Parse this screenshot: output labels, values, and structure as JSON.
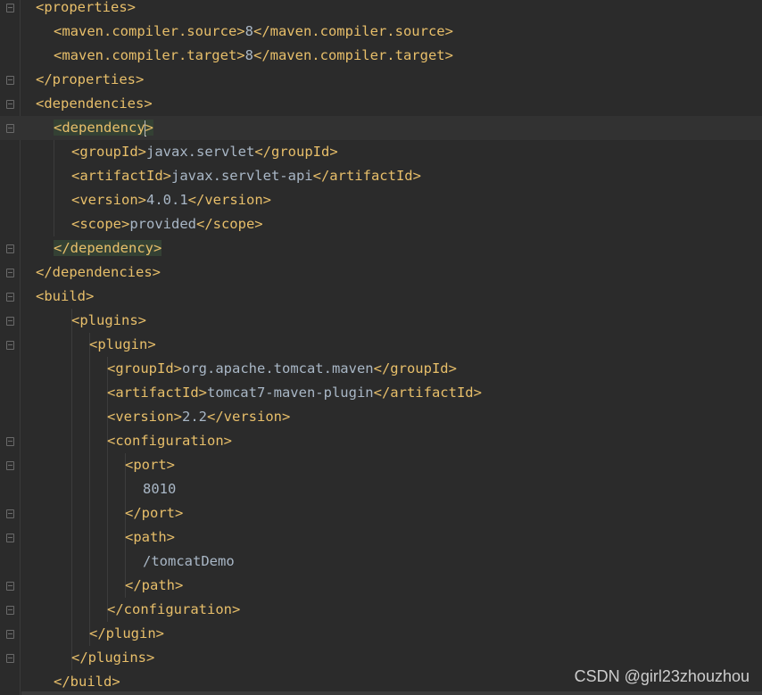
{
  "editor": {
    "lines": [
      {
        "indent": 2,
        "parts": [
          {
            "k": "tag",
            "t": "<properties>"
          }
        ]
      },
      {
        "indent": 3,
        "parts": [
          {
            "k": "tag",
            "t": "<maven.compiler.source>"
          },
          {
            "k": "txt",
            "t": "8"
          },
          {
            "k": "tag",
            "t": "</maven.compiler.source>"
          }
        ]
      },
      {
        "indent": 3,
        "parts": [
          {
            "k": "tag",
            "t": "<maven.compiler.target>"
          },
          {
            "k": "txt",
            "t": "8"
          },
          {
            "k": "tag",
            "t": "</maven.compiler.target>"
          }
        ]
      },
      {
        "indent": 2,
        "parts": [
          {
            "k": "tag",
            "t": "</properties>"
          }
        ]
      },
      {
        "indent": 2,
        "parts": [
          {
            "k": "tag",
            "t": "<dependencies>"
          }
        ]
      },
      {
        "indent": 3,
        "current": true,
        "parts": [
          {
            "k": "tag hl",
            "t": "<dependency"
          },
          {
            "k": "caret",
            "t": ""
          },
          {
            "k": "tag hl",
            "t": ">"
          }
        ]
      },
      {
        "indent": 4,
        "parts": [
          {
            "k": "tag",
            "t": "<groupId>"
          },
          {
            "k": "txt",
            "t": "javax.servlet"
          },
          {
            "k": "tag",
            "t": "</groupId>"
          }
        ]
      },
      {
        "indent": 4,
        "parts": [
          {
            "k": "tag",
            "t": "<artifactId>"
          },
          {
            "k": "txt",
            "t": "javax.servlet-api"
          },
          {
            "k": "tag",
            "t": "</artifactId>"
          }
        ]
      },
      {
        "indent": 4,
        "parts": [
          {
            "k": "tag",
            "t": "<version>"
          },
          {
            "k": "txt",
            "t": "4.0.1"
          },
          {
            "k": "tag",
            "t": "</version>"
          }
        ]
      },
      {
        "indent": 4,
        "parts": [
          {
            "k": "tag",
            "t": "<scope>"
          },
          {
            "k": "txt",
            "t": "provided"
          },
          {
            "k": "tag",
            "t": "</scope>"
          }
        ]
      },
      {
        "indent": 3,
        "parts": [
          {
            "k": "tag hl",
            "t": "</dependency>"
          }
        ]
      },
      {
        "indent": 2,
        "parts": [
          {
            "k": "tag",
            "t": "</dependencies>"
          }
        ]
      },
      {
        "indent": 2,
        "parts": [
          {
            "k": "tag",
            "t": "<build>"
          }
        ]
      },
      {
        "indent": 4,
        "parts": [
          {
            "k": "tag",
            "t": "<plugins>"
          }
        ]
      },
      {
        "indent": 5,
        "parts": [
          {
            "k": "tag",
            "t": "<plugin>"
          }
        ]
      },
      {
        "indent": 6,
        "parts": [
          {
            "k": "tag",
            "t": "<groupId>"
          },
          {
            "k": "txt",
            "t": "org.apache.tomcat.maven"
          },
          {
            "k": "tag",
            "t": "</groupId>"
          }
        ]
      },
      {
        "indent": 6,
        "parts": [
          {
            "k": "tag",
            "t": "<artifactId>"
          },
          {
            "k": "txt",
            "t": "tomcat7-maven-plugin"
          },
          {
            "k": "tag",
            "t": "</artifactId>"
          }
        ]
      },
      {
        "indent": 6,
        "parts": [
          {
            "k": "tag",
            "t": "<version>"
          },
          {
            "k": "txt",
            "t": "2.2"
          },
          {
            "k": "tag",
            "t": "</version>"
          }
        ]
      },
      {
        "indent": 6,
        "parts": [
          {
            "k": "tag",
            "t": "<configuration>"
          }
        ]
      },
      {
        "indent": 7,
        "parts": [
          {
            "k": "tag",
            "t": "<port>"
          }
        ]
      },
      {
        "indent": 8,
        "parts": [
          {
            "k": "txt",
            "t": "8010"
          }
        ]
      },
      {
        "indent": 7,
        "parts": [
          {
            "k": "tag",
            "t": "</port>"
          }
        ]
      },
      {
        "indent": 7,
        "parts": [
          {
            "k": "tag",
            "t": "<path>"
          }
        ]
      },
      {
        "indent": 8,
        "parts": [
          {
            "k": "txt",
            "t": "/tomcatDemo"
          }
        ]
      },
      {
        "indent": 7,
        "parts": [
          {
            "k": "tag",
            "t": "</path>"
          }
        ]
      },
      {
        "indent": 6,
        "parts": [
          {
            "k": "tag",
            "t": "</configuration>"
          }
        ]
      },
      {
        "indent": 5,
        "parts": [
          {
            "k": "tag",
            "t": "</plugin>"
          }
        ]
      },
      {
        "indent": 4,
        "parts": [
          {
            "k": "tag",
            "t": "</plugins>"
          }
        ]
      },
      {
        "indent": 3,
        "parts": [
          {
            "k": "tag",
            "t": "</build>"
          }
        ]
      }
    ],
    "fold_markers": [
      true,
      false,
      false,
      true,
      true,
      true,
      false,
      false,
      false,
      false,
      true,
      true,
      true,
      true,
      true,
      false,
      false,
      false,
      true,
      true,
      false,
      true,
      true,
      false,
      true,
      true,
      true,
      true,
      false
    ]
  },
  "watermark": {
    "text": "CSDN @girl23zhouzhou"
  },
  "colors": {
    "background": "#2b2b2b",
    "tag": "#e8bf6a",
    "text": "#a9b7c6",
    "highlight": "#344134",
    "current_line": "#323232"
  }
}
